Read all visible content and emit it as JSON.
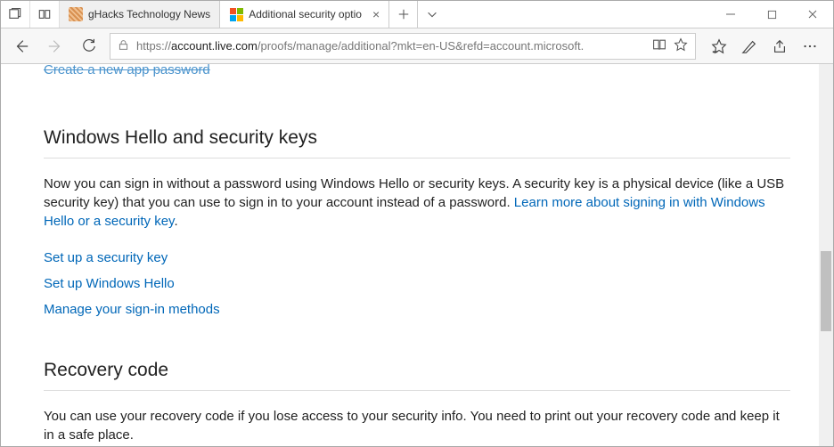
{
  "tabs": [
    {
      "label": "gHacks Technology News"
    },
    {
      "label": "Additional security optio"
    }
  ],
  "url": {
    "prefix": "https://",
    "host": "account.live.com",
    "path": "/proofs/manage/additional?mkt=en-US&refd=account.microsoft."
  },
  "page": {
    "top_link": "Create a new app password",
    "section1": {
      "heading": "Windows Hello and security keys",
      "desc_before": "Now you can sign in without a password using Windows Hello or security keys. A security key is a physical device (like a USB security key) that you can use to sign in to your account instead of a password. ",
      "learn_link": "Learn more about signing in with Windows Hello or a security key",
      "desc_after": ".",
      "links": [
        "Set up a security key",
        "Set up Windows Hello",
        "Manage your sign-in methods"
      ]
    },
    "section2": {
      "heading": "Recovery code",
      "desc": "You can use your recovery code if you lose access to your security info. You need to print out your recovery code and keep it in a safe place."
    }
  }
}
